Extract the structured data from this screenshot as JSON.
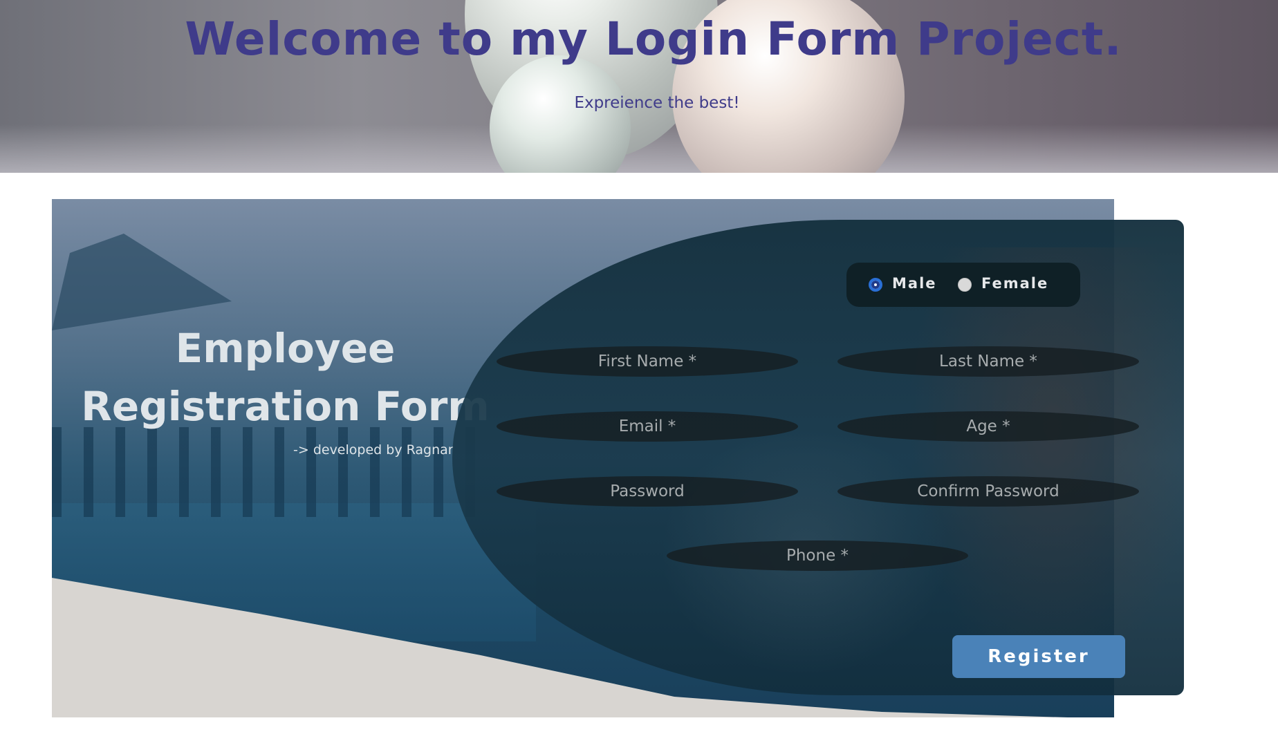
{
  "header": {
    "title": "Welcome to my Login Form Project.",
    "subtitle": "Expreience the best!"
  },
  "form_card": {
    "heading_line1": "Employee",
    "heading_line2": "Registration Form",
    "credit": "-> developed by Ragnar"
  },
  "gender": {
    "options": [
      {
        "label": "Male",
        "selected": true
      },
      {
        "label": "Female",
        "selected": false
      }
    ]
  },
  "fields": {
    "first_name": "First Name *",
    "last_name": "Last Name *",
    "email": "Email *",
    "age": "Age *",
    "password": "Password",
    "confirm_password": "Confirm Password",
    "phone": "Phone *"
  },
  "actions": {
    "register_label": "Register"
  },
  "colors": {
    "title": "#3f3b8a",
    "register_button": "#4a82b8",
    "radio_selected": "#2a6fd6"
  }
}
